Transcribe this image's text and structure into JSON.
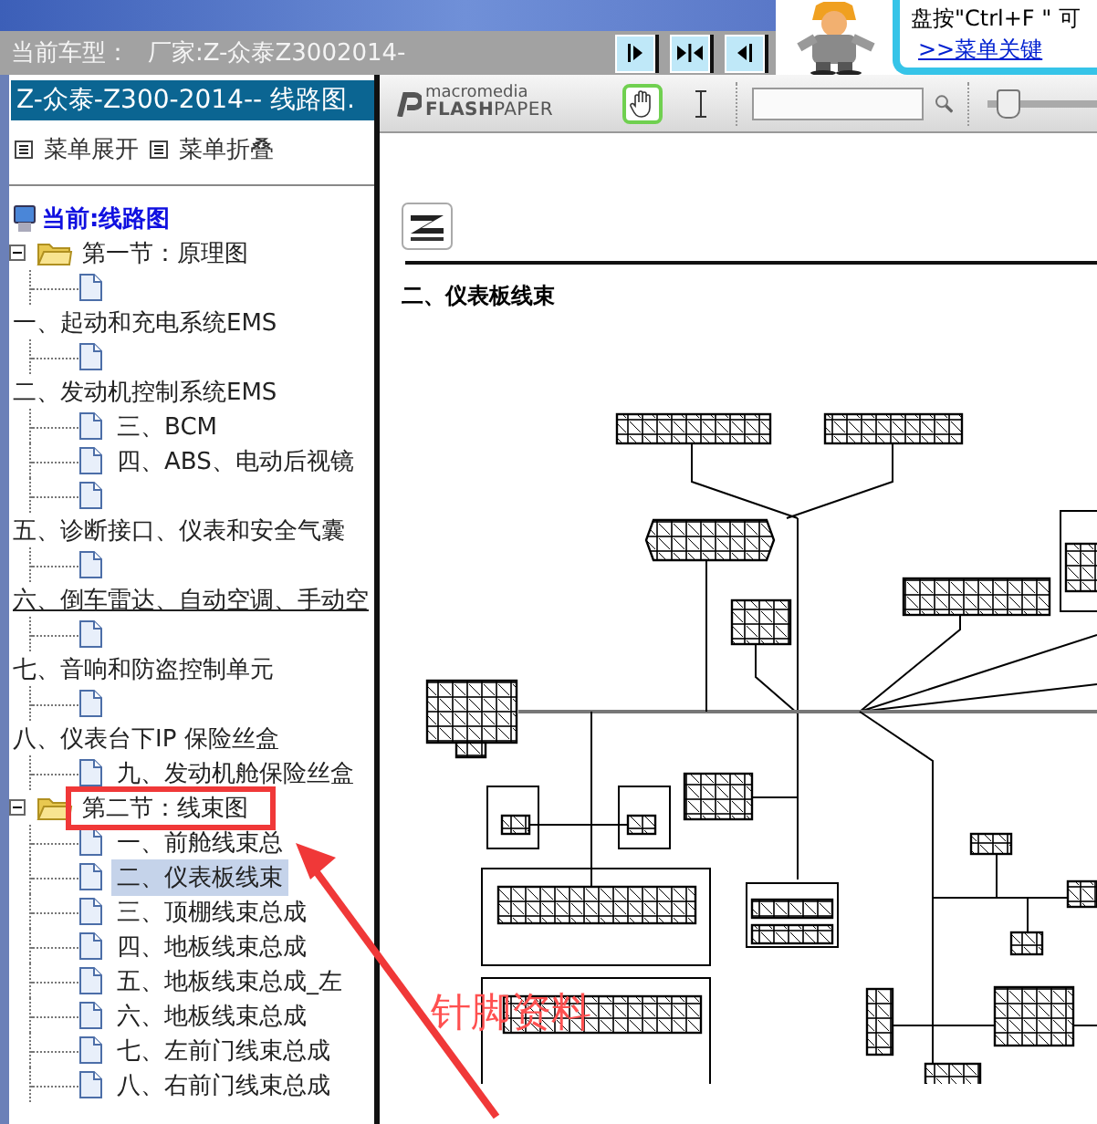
{
  "top_bar": {
    "vehicle_label": "当前车型：",
    "vehicle_value": "厂家:Z-众泰Z3002014-"
  },
  "tip": {
    "text": "盘按\"Ctrl+F \" 可",
    "link": ">>菜单关键"
  },
  "sidebar": {
    "title": "Z-众泰-Z300-2014-- 线路图.",
    "menu_actions": [
      "菜单展开",
      "菜单折叠"
    ],
    "tree": [
      {
        "kind": "current",
        "label": "当前:线路图"
      },
      {
        "kind": "folder",
        "label": "第一节：原理图",
        "expanded": true,
        "children": [
          {
            "kind": "page",
            "selected": false
          },
          {
            "kind": "caption",
            "label": "一、起动和充电系统EMS",
            "hovered": false
          },
          {
            "kind": "page",
            "selected": false
          },
          {
            "kind": "caption",
            "label": "二、发动机控制系统EMS",
            "hovered": false
          },
          {
            "kind": "page",
            "label": "三、BCM",
            "selected": false
          },
          {
            "kind": "page",
            "label": "四、ABS、电动后视镜",
            "selected": false
          },
          {
            "kind": "page",
            "selected": false
          },
          {
            "kind": "caption",
            "label": "五、诊断接口、仪表和安全气囊",
            "hovered": false
          },
          {
            "kind": "page",
            "selected": false
          },
          {
            "kind": "caption",
            "label": "六、倒车雷达、自动空调、手动空",
            "hovered": true
          },
          {
            "kind": "page",
            "selected": false
          },
          {
            "kind": "caption",
            "label": "七、音响和防盗控制单元",
            "hovered": false
          },
          {
            "kind": "page",
            "selected": false
          },
          {
            "kind": "caption",
            "label": "八、仪表台下IP 保险丝盒",
            "hovered": false
          },
          {
            "kind": "page",
            "label": "九、发动机舱保险丝盒",
            "selected": false
          }
        ]
      },
      {
        "kind": "folder",
        "label": "第二节：线束图",
        "expanded": true,
        "children": [
          {
            "kind": "page",
            "label": "一、前舱线束总",
            "selected": false
          },
          {
            "kind": "page",
            "label": "二、仪表板线束",
            "selected": true
          },
          {
            "kind": "page",
            "label": "三、顶棚线束总成",
            "selected": false
          },
          {
            "kind": "page",
            "label": "四、地板线束总成",
            "selected": false
          },
          {
            "kind": "page",
            "label": "五、地板线束总成_左",
            "selected": false
          },
          {
            "kind": "page",
            "label": "六、地板线束总成",
            "selected": false
          },
          {
            "kind": "page",
            "label": "七、左前门线束总成",
            "selected": false
          },
          {
            "kind": "page",
            "label": "八、右前门线束总成",
            "selected": false
          }
        ]
      }
    ]
  },
  "viewer": {
    "logo": {
      "small": "macromedia",
      "large": "**FLASH**PAPER"
    },
    "tools": [
      {
        "kind": "hand",
        "selected": true
      },
      {
        "kind": "text-select",
        "selected": false
      }
    ],
    "zoom": {
      "level": 0.18
    },
    "document": {
      "heading": "二、仪表板线束"
    }
  },
  "annotation": {
    "label": "针脚资料"
  }
}
